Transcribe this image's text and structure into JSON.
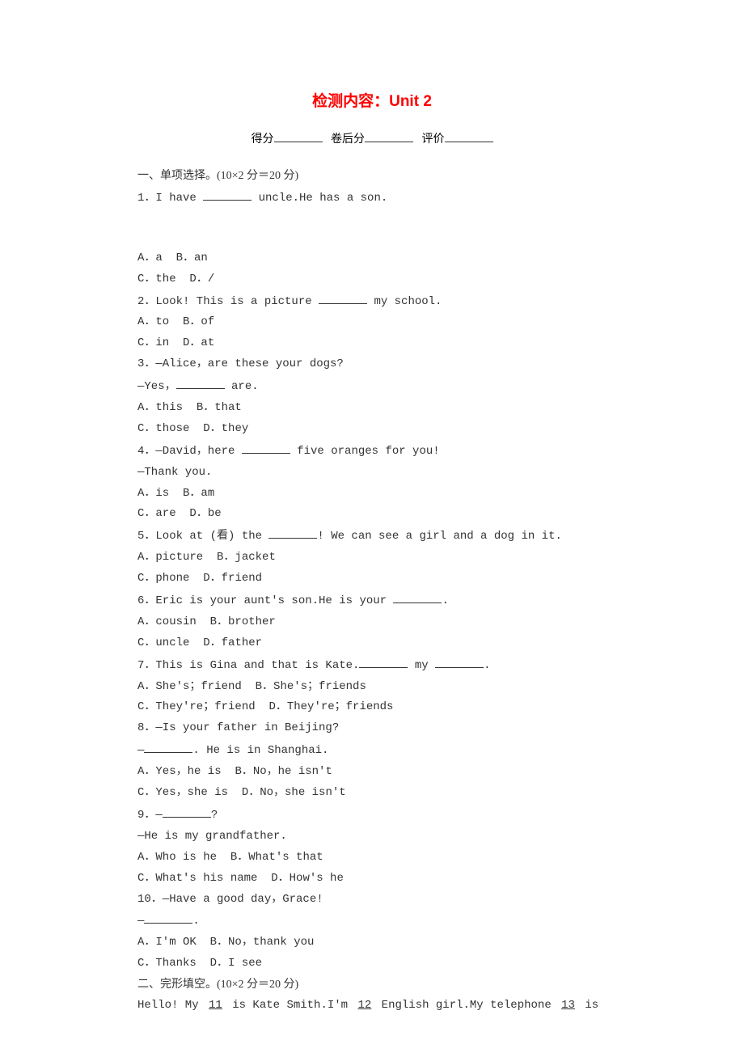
{
  "title": "检测内容：Unit 2",
  "scoreline": {
    "score": "得分",
    "juanhou": "卷后分",
    "pingjia": "评价"
  },
  "section1": {
    "header": "一、单项选择。(10×2 分＝20 分)",
    "q1": {
      "prompt_a": "1．I have ",
      "prompt_b": " uncle.He has a son.",
      "optA": "A．a",
      "optB": "B．an",
      "optC": "C．the",
      "optD": "D．/"
    },
    "q2": {
      "prompt_a": "2．Look! This is a picture ",
      "prompt_b": " my school.",
      "optA": "A．to",
      "optB": "B．of",
      "optC": "C．in",
      "optD": "D．at"
    },
    "q3": {
      "prompt": "3．—Alice，are these your dogs?",
      "response_a": "—Yes，",
      "response_b": " are.",
      "optA": "A．this",
      "optB": "B．that",
      "optC": "C．those",
      "optD": "D．they"
    },
    "q4": {
      "prompt_a": "4．—David，here ",
      "prompt_b": " five oranges for you!",
      "response": "—Thank you.",
      "optA": "A．is",
      "optB": "B．am",
      "optC": "C．are",
      "optD": "D．be"
    },
    "q5": {
      "prompt_a": "5．Look at (看) the ",
      "prompt_b": "! We can see a girl and a dog in it.",
      "optA": "A．picture",
      "optB": "B．jacket",
      "optC": "C．phone",
      "optD": "D．friend"
    },
    "q6": {
      "prompt_a": "6．Eric is your aunt's son.He is your ",
      "prompt_b": ".",
      "optA": "A．cousin",
      "optB": "B．brother",
      "optC": "C．uncle",
      "optD": "D．father"
    },
    "q7": {
      "prompt_a": "7．This is Gina and that is Kate.",
      "prompt_b": " my ",
      "prompt_c": ".",
      "optA": "A．She's；friend",
      "optB": "B．She's；friends",
      "optC": "C．They're；friend",
      "optD": "D．They're；friends"
    },
    "q8": {
      "prompt": "8．—Is your father in Beijing?",
      "response_a": "—",
      "response_b": ". He is in Shanghai.",
      "optA": "A．Yes，he is",
      "optB": "B．No，he isn't",
      "optC": "C．Yes，she is",
      "optD": "D．No，she isn't"
    },
    "q9": {
      "prompt_a": "9．—",
      "prompt_b": "?",
      "response": "—He is my grandfather.",
      "optA": "A．Who is he",
      "optB": "B．What's that",
      "optC": "C．What's his name",
      "optD": "D．How's he"
    },
    "q10": {
      "prompt": "10．—Have a good day，Grace!",
      "response_a": "—",
      "response_b": ".",
      "optA": "A．I'm OK",
      "optB": "B．No，thank you",
      "optC": "C．Thanks",
      "optD": "D．I see"
    }
  },
  "section2": {
    "header": "二、完形填空。(10×2 分＝20 分)",
    "text_a": "Hello! My ",
    "num11": "11",
    "text_b": " is Kate Smith.I'm ",
    "num12": "12",
    "text_c": " English girl.My telephone ",
    "num13": "13",
    "text_d": " is"
  }
}
